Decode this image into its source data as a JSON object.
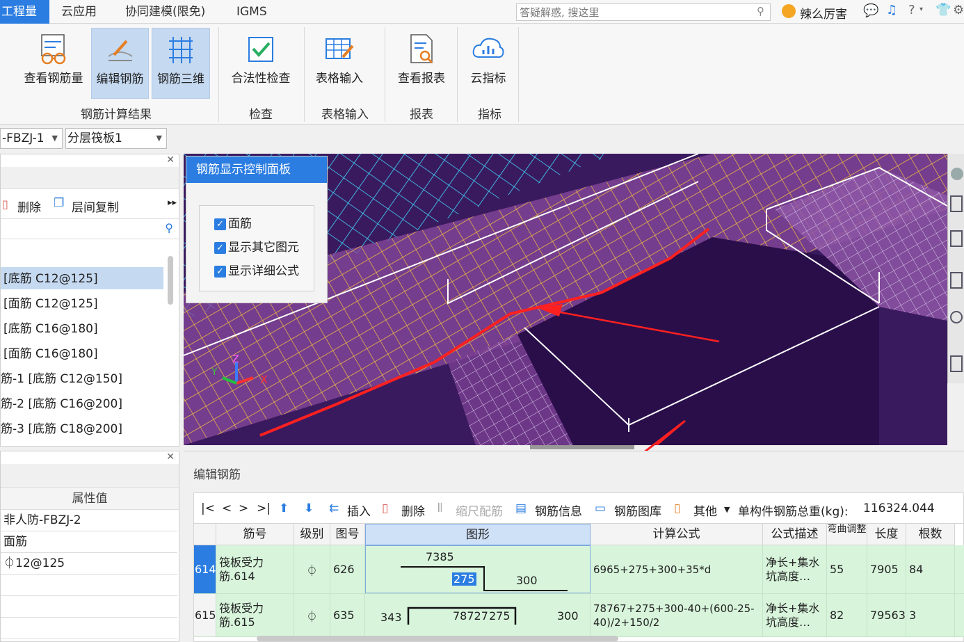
{
  "tabs": [
    {
      "label": "工程量",
      "active": true
    },
    {
      "label": "云应用",
      "active": false
    },
    {
      "label": "协同建模(限免)",
      "active": false
    },
    {
      "label": "IGMS",
      "active": false
    }
  ],
  "search": {
    "placeholder": "答疑解惑, 搜这里"
  },
  "user": {
    "name": "辣么厉害"
  },
  "ribbon": {
    "buttons": [
      {
        "label": "查看钢筋量",
        "icon": "rebar-glasses-icon"
      },
      {
        "label": "编辑钢筋",
        "icon": "edit-rebar-icon",
        "selected": true
      },
      {
        "label": "钢筋三维",
        "icon": "rebar-3d-icon",
        "selected": true
      },
      {
        "label": "合法性检查",
        "icon": "check-icon"
      },
      {
        "label": "表格输入",
        "icon": "table-input-icon"
      },
      {
        "label": "查看报表",
        "icon": "report-icon"
      },
      {
        "label": "云指标",
        "icon": "cloud-index-icon"
      }
    ],
    "groups": [
      "钢筋计算结果",
      "检查",
      "表格输入",
      "报表",
      "指标"
    ]
  },
  "selectors": {
    "component": "-FBZJ-1",
    "layer": "分层筏板1"
  },
  "left_panel": {
    "delete_label": "删除",
    "copy_label": "层间复制",
    "items": [
      "[底筋 C12@125]",
      "[面筋 C12@125]",
      "[底筋 C16@180]",
      "[面筋 C16@180]",
      "筋-1 [底筋 C12@150]",
      "筋-2 [底筋 C16@200]",
      "筋-3 [底筋 C18@200]"
    ]
  },
  "props_panel": {
    "header": "属性值",
    "values": [
      "非人防-FBZJ-2",
      "面筋",
      "⏀12@125"
    ]
  },
  "control_panel": {
    "title": "钢筋显示控制面板",
    "options": [
      "面筋",
      "显示其它图元",
      "显示详细公式"
    ]
  },
  "edit_panel": {
    "title": "编辑钢筋",
    "toolbar": {
      "insert": "插入",
      "delete": "删除",
      "scale": "缩尺配筋",
      "info": "钢筋信息",
      "library": "钢筋图库",
      "other": "其他",
      "total_label": "单构件钢筋总重(kg):",
      "total_value": "116324.044"
    },
    "columns": [
      "筋号",
      "级别",
      "图号",
      "图形",
      "计算公式",
      "公式描述",
      "弯曲调整",
      "长度",
      "根数"
    ],
    "rows": [
      {
        "num": "614",
        "name": "筏板受力筋.614",
        "grade": "⏀",
        "fig": "626",
        "shape": {
          "top": "7385",
          "mid": "275",
          "right": "300"
        },
        "formula": "6965+275+300+35*d",
        "desc": "净长+集水坑高度…",
        "bend": "55",
        "length": "7905",
        "count": "84"
      },
      {
        "num": "615",
        "name": "筏板受力筋.615",
        "grade": "⏀",
        "fig": "635",
        "shape": {
          "a": "343",
          "b": "78727",
          "c": "275",
          "d": "300"
        },
        "formula": "78767+275+300-40+(600-25-40)/2+150/2",
        "desc": "净长+集水坑高度…",
        "bend": "82",
        "length": "79563",
        "count": "3"
      }
    ]
  },
  "colors": {
    "accent": "#2b7de1",
    "viewport_bg": "#3a1a5e",
    "row_bg": "#d8f5dc",
    "annotation": "#ff2020"
  }
}
